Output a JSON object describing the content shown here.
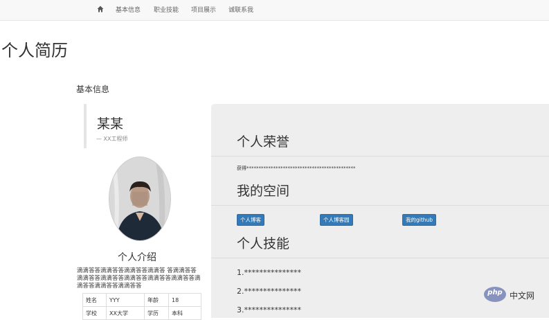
{
  "nav": {
    "home_icon": "home-icon",
    "items": [
      "基本信息",
      "职业技能",
      "项目展示",
      "诚联系我"
    ]
  },
  "page": {
    "title": "个人简历",
    "section_heading": "基本信息"
  },
  "profile": {
    "name": "某某",
    "subtitle": "— XX工程师",
    "intro_heading": "个人介绍",
    "intro_text": "滴滴答答滴滴答答滴滴答答滴滴答 答滴滴答答滴滴答答滴滴答答滴滴答答滴滴答答滴滴答答滴滴答答滴滴答答滴滴答答",
    "table_rows": [
      [
        "姓名",
        "YYY",
        "年龄",
        "18"
      ],
      [
        "学校",
        "XX大学",
        "学历",
        "本科"
      ]
    ]
  },
  "panel": {
    "honor_heading": "个人荣誉",
    "honor_text": "获得*********************************************",
    "space_heading": "我的空间",
    "links": [
      "个人博客",
      "个人博客园",
      "我的github"
    ],
    "skills_heading": "个人技能",
    "skills": [
      "1.***************",
      "2.***************",
      "3.***************"
    ]
  },
  "watermark": {
    "logo_text": "php",
    "site_text": "中文网"
  },
  "colors": {
    "navbar_bg": "#f8f8f8",
    "panel_bg": "#eeeeee",
    "button_blue": "#337ab7"
  }
}
